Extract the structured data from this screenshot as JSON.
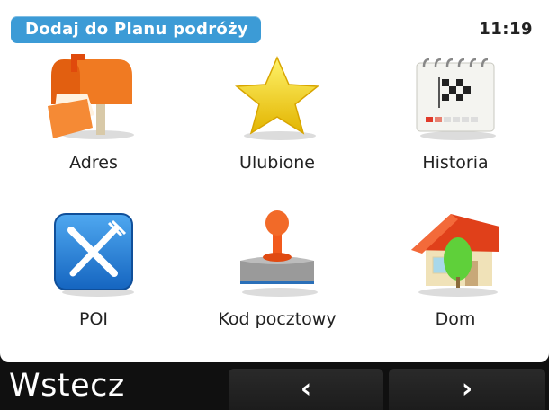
{
  "header": {
    "title": "Dodaj do Planu podróży",
    "time": "11:19"
  },
  "tiles": [
    {
      "label": "Adres",
      "icon": "mailbox-icon"
    },
    {
      "label": "Ulubione",
      "icon": "star-icon"
    },
    {
      "label": "Historia",
      "icon": "calendar-checkered-flag-icon"
    },
    {
      "label": "POI",
      "icon": "knife-fork-icon"
    },
    {
      "label": "Kod pocztowy",
      "icon": "stamp-icon"
    },
    {
      "label": "Dom",
      "icon": "house-icon"
    }
  ],
  "footer": {
    "back_label": "Wstecz",
    "prev_symbol": "‹",
    "next_symbol": "›"
  },
  "colors": {
    "header_bg": "#3c9bd6",
    "screen_bg": "#ffffff",
    "bar_bg": "#101010"
  }
}
